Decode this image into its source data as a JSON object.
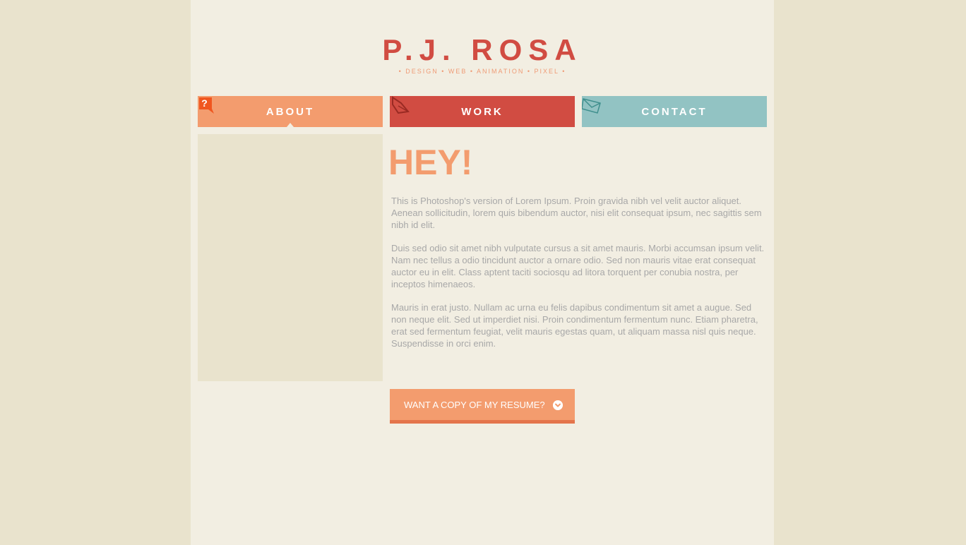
{
  "header": {
    "logo": "P.J. ROSA",
    "tagline": "• DESIGN • WEB • ANIMATION • PIXEL •"
  },
  "nav": {
    "tabs": [
      {
        "label": "ABOUT",
        "icon": "question-bubble-icon"
      },
      {
        "label": "WORK",
        "icon": "pen-nib-icon"
      },
      {
        "label": "CONTACT",
        "icon": "envelope-icon"
      }
    ]
  },
  "main": {
    "heading": "HEY!",
    "paragraphs": [
      "This is Photoshop's version  of Lorem Ipsum. Proin gravida nibh vel velit auctor aliquet. Aenean sollicitudin, lorem quis bibendum auctor, nisi elit consequat ipsum, nec sagittis sem nibh id elit.",
      "Duis sed odio sit amet nibh vulputate cursus a sit amet mauris. Morbi accumsan ipsum velit. Nam nec tellus a odio tincidunt auctor a ornare odio. Sed non  mauris vitae erat consequat auctor eu in elit. Class aptent taciti sociosqu ad litora torquent per conubia nostra, per inceptos himenaeos.",
      "Mauris in erat justo. Nullam ac urna eu felis dapibus condimentum sit amet a augue. Sed non neque elit. Sed ut imperdiet nisi. Proin condimentum fermentum nunc. Etiam pharetra, erat sed fermentum feugiat, velit mauris egestas quam, ut aliquam massa nisl quis neque. Suspendisse in orci enim."
    ],
    "resume_button": "WANT A COPY OF MY RESUME?"
  },
  "colors": {
    "background": "#e9e3cd",
    "page": "#f2eee2",
    "brand_red": "#d14c42",
    "accent_orange": "#f39c6e",
    "accent_teal": "#92c3c3",
    "body_text": "#a8a8a8"
  }
}
